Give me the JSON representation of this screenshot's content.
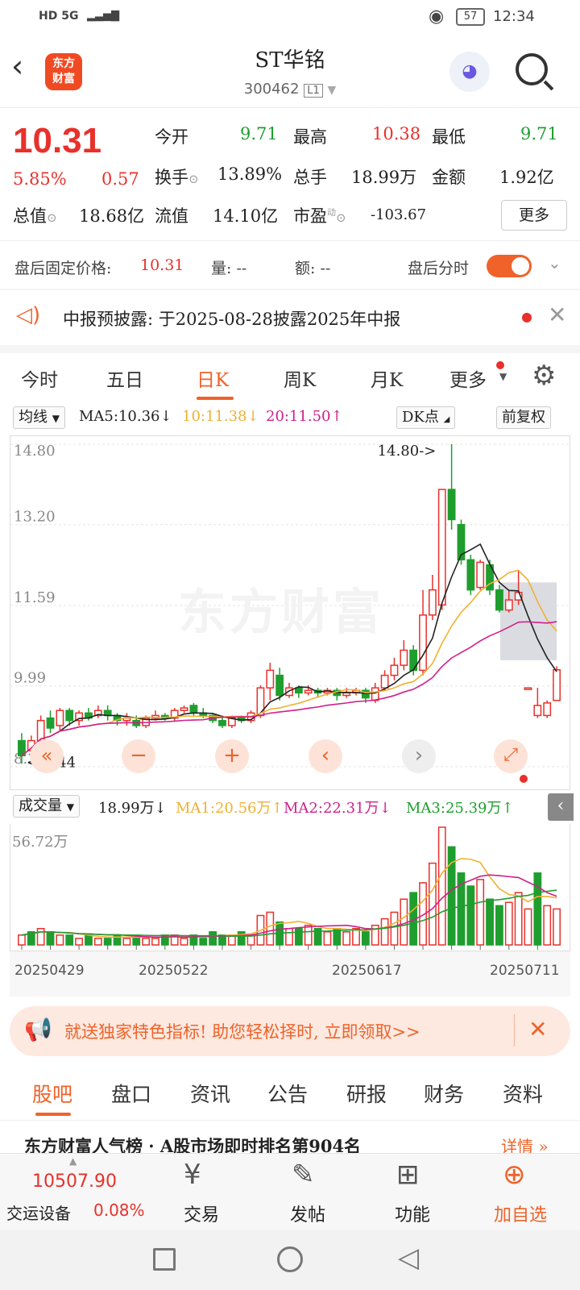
{
  "status": {
    "network": "HD 5G",
    "time": "12:34",
    "battery": "57"
  },
  "header": {
    "logo_line1": "东方",
    "logo_line2": "财富",
    "title": "ST华铭",
    "code": "300462"
  },
  "quote": {
    "price": "10.31",
    "change_pct": "5.85%",
    "change": "0.57",
    "open_label": "今开",
    "open": "9.71",
    "high_label": "最高",
    "high": "10.38",
    "low_label": "最低",
    "low": "9.71",
    "turnover_label": "换手",
    "turnover": "13.89%",
    "volume_label": "总手",
    "volume": "18.99万",
    "amount_label": "金额",
    "amount": "1.92亿",
    "mcap_label": "总值",
    "mcap": "18.68亿",
    "float_label": "流值",
    "float": "14.10亿",
    "pe_label": "市盈",
    "pe_sup": "动",
    "pe": "-103.67",
    "more_label": "更多"
  },
  "afterhours": {
    "label": "盘后固定价格:",
    "price": "10.31",
    "vol_label": "量: --",
    "amt_label": "额: --",
    "toggle_label": "盘后分时"
  },
  "notice": {
    "text": "中报预披露: 于2025-08-28披露2025年中报"
  },
  "chart_tabs": [
    "今时",
    "五日",
    "日K",
    "周K",
    "月K",
    "更多"
  ],
  "ma_bar": {
    "dropdown": "均线",
    "ma5": "MA5:10.36",
    "ma10": "10:11.38",
    "ma20": "20:11.50",
    "dk": "DK点",
    "adjust": "前复权"
  },
  "vol_bar": {
    "dropdown": "成交量",
    "vol": "18.99万",
    "ma1": "MA1:20.56万",
    "ma2": "MA2:22.31万",
    "ma3": "MA3:25.39万"
  },
  "watermark": "东方财富",
  "colors": {
    "up": "#e8312b",
    "down": "#1f9e2f",
    "accent": "#f0622a",
    "ma5": "#222222",
    "ma10": "#f0b032",
    "ma20": "#d0208a"
  },
  "chart_data": {
    "type": "candlestick",
    "y_ticks": [
      "14.80",
      "13.20",
      "11.59",
      "9.99",
      "8.38"
    ],
    "ylim": [
      8.38,
      14.8
    ],
    "high_annotation": "14.80->",
    "low_annotation": "<-8.44",
    "x_ticks": [
      "20250429",
      "20250522",
      "20250617",
      "20250711"
    ],
    "candles": [
      [
        8.9,
        8.6,
        9.05,
        8.44
      ],
      [
        8.7,
        8.9,
        9.0,
        8.6
      ],
      [
        8.9,
        9.3,
        9.4,
        8.85
      ],
      [
        9.35,
        9.15,
        9.5,
        9.05
      ],
      [
        9.2,
        9.5,
        9.55,
        9.1
      ],
      [
        9.5,
        9.3,
        9.55,
        9.2
      ],
      [
        9.3,
        9.45,
        9.5,
        9.2
      ],
      [
        9.45,
        9.35,
        9.55,
        9.3
      ],
      [
        9.4,
        9.5,
        9.6,
        9.35
      ],
      [
        9.5,
        9.4,
        9.6,
        9.3
      ],
      [
        9.4,
        9.3,
        9.45,
        9.2
      ],
      [
        9.3,
        9.35,
        9.45,
        9.2
      ],
      [
        9.3,
        9.2,
        9.4,
        9.15
      ],
      [
        9.2,
        9.35,
        9.4,
        9.15
      ],
      [
        9.35,
        9.4,
        9.5,
        9.3
      ],
      [
        9.4,
        9.35,
        9.45,
        9.3
      ],
      [
        9.35,
        9.5,
        9.55,
        9.3
      ],
      [
        9.5,
        9.55,
        9.6,
        9.45
      ],
      [
        9.6,
        9.45,
        9.65,
        9.4
      ],
      [
        9.45,
        9.4,
        9.55,
        9.35
      ],
      [
        9.4,
        9.3,
        9.45,
        9.25
      ],
      [
        9.3,
        9.2,
        9.4,
        9.15
      ],
      [
        9.2,
        9.35,
        9.4,
        9.15
      ],
      [
        9.35,
        9.3,
        9.4,
        9.25
      ],
      [
        9.3,
        9.45,
        9.5,
        9.25
      ],
      [
        9.4,
        9.95,
        10.0,
        9.35
      ],
      [
        9.95,
        10.3,
        10.45,
        9.7
      ],
      [
        10.2,
        9.8,
        10.35,
        9.7
      ],
      [
        9.8,
        9.95,
        10.05,
        9.75
      ],
      [
        9.95,
        9.85,
        10.0,
        9.75
      ],
      [
        9.85,
        9.9,
        10.0,
        9.8
      ],
      [
        9.9,
        9.85,
        9.95,
        9.75
      ],
      [
        9.85,
        9.9,
        9.95,
        9.8
      ],
      [
        9.9,
        9.8,
        9.95,
        9.7
      ],
      [
        9.8,
        9.85,
        9.95,
        9.75
      ],
      [
        9.85,
        9.9,
        9.95,
        9.8
      ],
      [
        9.9,
        9.75,
        9.95,
        9.65
      ],
      [
        9.7,
        9.95,
        10.05,
        9.65
      ],
      [
        9.95,
        10.2,
        10.3,
        9.9
      ],
      [
        10.2,
        10.4,
        10.55,
        10.1
      ],
      [
        10.4,
        10.7,
        10.9,
        10.3
      ],
      [
        10.7,
        10.3,
        10.8,
        10.2
      ],
      [
        10.3,
        11.4,
        11.9,
        10.2
      ],
      [
        11.4,
        11.9,
        12.2,
        11.3
      ],
      [
        11.6,
        13.9,
        13.9,
        11.5
      ],
      [
        13.9,
        13.3,
        14.8,
        13.1
      ],
      [
        13.2,
        12.5,
        13.3,
        12.4
      ],
      [
        12.5,
        11.9,
        12.6,
        11.8
      ],
      [
        11.95,
        12.45,
        12.5,
        11.9
      ],
      [
        12.4,
        11.9,
        12.5,
        11.8
      ],
      [
        11.9,
        11.5,
        12.0,
        11.45
      ],
      [
        11.5,
        11.7,
        11.9,
        11.45
      ],
      [
        11.7,
        11.85,
        12.3,
        11.6
      ],
      [
        9.95,
        9.95,
        9.95,
        9.95
      ],
      [
        9.4,
        9.6,
        9.95,
        9.35
      ],
      [
        9.4,
        9.65,
        9.7,
        9.35
      ],
      [
        9.7,
        10.31,
        10.38,
        9.71
      ]
    ]
  },
  "vol_data": {
    "top_label": "56.72万",
    "values": [
      3,
      4,
      5,
      4,
      3,
      3,
      2,
      3,
      2,
      2,
      3,
      2,
      3,
      2,
      2,
      3,
      3,
      2,
      3,
      2,
      4,
      3,
      3,
      4,
      3,
      9,
      10,
      7,
      5,
      5,
      6,
      5,
      4,
      5,
      4,
      5,
      4,
      6,
      8,
      10,
      14,
      16,
      19,
      25,
      36,
      30,
      22,
      18,
      20,
      14,
      12,
      13,
      16,
      11,
      22,
      12,
      11
    ],
    "up": [
      1,
      0,
      1,
      0,
      1,
      0,
      1,
      0,
      1,
      0,
      0,
      1,
      0,
      1,
      1,
      0,
      1,
      1,
      0,
      0,
      0,
      0,
      1,
      0,
      1,
      1,
      1,
      0,
      1,
      0,
      1,
      0,
      1,
      0,
      1,
      1,
      0,
      1,
      1,
      1,
      1,
      0,
      1,
      1,
      1,
      0,
      0,
      0,
      1,
      0,
      0,
      1,
      1,
      1,
      0,
      1,
      1
    ]
  },
  "promo": {
    "text": "就送独家特色指标! 助您轻松择时, 立即领取>>"
  },
  "info_tabs": [
    "股吧",
    "盘口",
    "资讯",
    "公告",
    "研报",
    "财务",
    "资料"
  ],
  "ranking": {
    "text": "东方财富人气榜 · A股市场即时排名第904名",
    "detail": "详情"
  },
  "bottom": {
    "index_value": "10507.90",
    "index_name": "交运设备",
    "index_pct": "0.08%",
    "trade": "交易",
    "post": "发帖",
    "func": "功能",
    "add": "加自选"
  }
}
